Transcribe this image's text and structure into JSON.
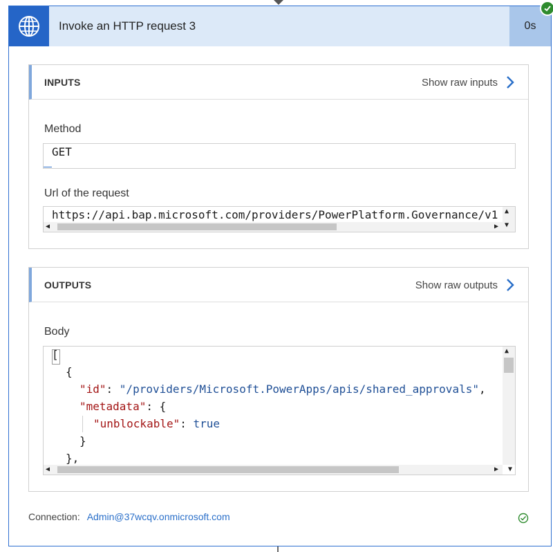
{
  "action": {
    "title": "Invoke an HTTP request 3",
    "duration": "0s",
    "icon": "globe-icon",
    "status_icon": "success-check-icon"
  },
  "inputs": {
    "section_title": "INPUTS",
    "raw_link": "Show raw inputs",
    "method_label": "Method",
    "method_value": "GET",
    "url_label": "Url of the request",
    "url_value": "https://api.bap.microsoft.com/providers/PowerPlatform.Governance/v1"
  },
  "outputs": {
    "section_title": "OUTPUTS",
    "raw_link": "Show raw outputs",
    "body_label": "Body",
    "body_lines": {
      "l1": "[",
      "l2": "{",
      "l3_key": "\"id\"",
      "l3_sep": ": ",
      "l3_val": "\"/providers/Microsoft.PowerApps/apis/shared_approvals\"",
      "l3_end": ",",
      "l4_key": "\"metadata\"",
      "l4_sep": ": {",
      "l5_key": "\"unblockable\"",
      "l5_sep": ": ",
      "l5_val": "true",
      "l6": "}",
      "l7": "},"
    }
  },
  "connection": {
    "label": "Connection:",
    "account": "Admin@37wcqv.onmicrosoft.com"
  },
  "colors": {
    "accent": "#2565c7",
    "header_bg": "#dce9f8",
    "success": "#2e8b2e",
    "link": "#2a6fc9"
  }
}
